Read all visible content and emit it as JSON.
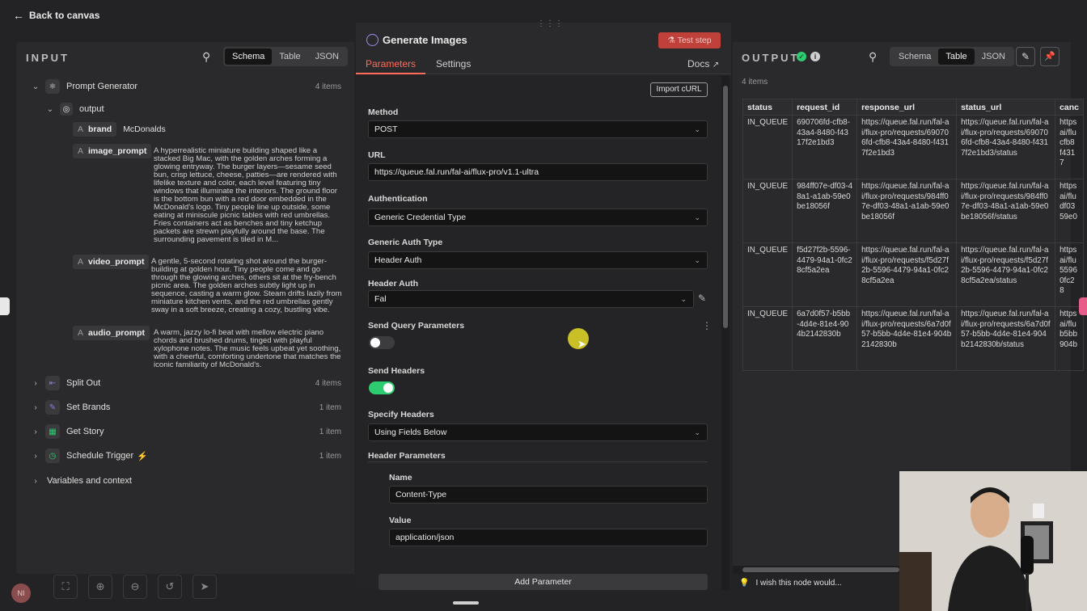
{
  "nav": {
    "back_label": "Back to canvas"
  },
  "input": {
    "title": "INPUT",
    "view_tabs": [
      "Schema",
      "Table",
      "JSON"
    ],
    "active_tab": "Schema",
    "root_node": {
      "name": "Prompt Generator",
      "count": "4 items"
    },
    "output_key": "output",
    "fields": [
      {
        "key": "brand",
        "value": "McDonalds"
      },
      {
        "key": "image_prompt",
        "value": "A hyperrealistic miniature building shaped like a stacked Big Mac, with the golden arches forming a glowing entryway. The burger layers—sesame seed bun, crisp lettuce, cheese, patties—are rendered with lifelike texture and color, each level featuring tiny windows that illuminate the interiors. The ground floor is the bottom bun with a red door embedded in the McDonald's logo. Tiny people line up outside, some eating at miniscule picnic tables with red umbrellas. Fries containers act as benches and tiny ketchup packets are strewn playfully around the base. The surrounding pavement is tiled in M..."
      },
      {
        "key": "video_prompt",
        "value": "A gentle, 5-second rotating shot around the burger-building at golden hour. Tiny people come and go through the glowing arches, others sit at the fry-bench picnic area. The golden arches subtly light up in sequence, casting a warm glow. Steam drifts lazily from miniature kitchen vents, and the red umbrellas gently sway in a soft breeze, creating a cozy, bustling vibe."
      },
      {
        "key": "audio_prompt",
        "value": "A warm, jazzy lo-fi beat with mellow electric piano chords and brushed drums, tinged with playful xylophone notes. The music feels upbeat yet soothing, with a cheerful, comforting undertone that matches the iconic familiarity of McDonald's."
      }
    ],
    "other_nodes": [
      {
        "name": "Split Out",
        "count": "4 items",
        "color": "#7b5cd6"
      },
      {
        "name": "Set Brands",
        "count": "1 item",
        "color": "#6a55c8"
      },
      {
        "name": "Get Story",
        "count": "1 item",
        "color": "#2e9d55"
      },
      {
        "name": "Schedule Trigger",
        "count": "1 item",
        "color": "#22a06b"
      }
    ],
    "variables_label": "Variables and context"
  },
  "params": {
    "node_title": "Generate Images",
    "test_step_label": "Test step",
    "tabs": [
      "Parameters",
      "Settings"
    ],
    "docs_label": "Docs",
    "import_curl_label": "Import cURL",
    "method_label": "Method",
    "method_value": "POST",
    "url_label": "URL",
    "url_value": "https://queue.fal.run/fal-ai/flux-pro/v1.1-ultra",
    "auth_label": "Authentication",
    "auth_value": "Generic Credential Type",
    "generic_auth_label": "Generic Auth Type",
    "generic_auth_value": "Header Auth",
    "header_auth_label": "Header Auth",
    "header_auth_value": "Fal",
    "send_query_label": "Send Query Parameters",
    "send_query_on": false,
    "send_headers_label": "Send Headers",
    "send_headers_on": true,
    "specify_headers_label": "Specify Headers",
    "specify_headers_value": "Using Fields Below",
    "header_params_label": "Header Parameters",
    "name_label": "Name",
    "name_value": "Content-Type",
    "value_label": "Value",
    "value_value": "application/json",
    "add_param_label": "Add Parameter"
  },
  "output": {
    "title": "OUTPUT",
    "view_tabs": [
      "Schema",
      "Table",
      "JSON"
    ],
    "active_tab": "Table",
    "count": "4 items",
    "columns": [
      "status",
      "request_id",
      "response_url",
      "status_url",
      "canc"
    ],
    "rows": [
      [
        "IN_QUEUE",
        "690706fd-cfb8-43a4-8480-f4317f2e1bd3",
        "https://queue.fal.run/fal-ai/flux-pro/requests/690706fd-cfb8-43a4-8480-f4317f2e1bd3",
        "https://queue.fal.run/fal-ai/flux-pro/requests/690706fd-cfb8-43a4-8480-f4317f2e1bd3/status",
        "https ai/flu cfb8 f4317"
      ],
      [
        "IN_QUEUE",
        "984ff07e-df03-48a1-a1ab-59e0be18056f",
        "https://queue.fal.run/fal-ai/flux-pro/requests/984ff07e-df03-48a1-a1ab-59e0be18056f",
        "https://queue.fal.run/fal-ai/flux-pro/requests/984ff07e-df03-48a1-a1ab-59e0be18056f/status",
        "https ai/flu df03 59e0"
      ],
      [
        "IN_QUEUE",
        "f5d27f2b-5596-4479-94a1-0fc28cf5a2ea",
        "https://queue.fal.run/fal-ai/flux-pro/requests/f5d27f2b-5596-4479-94a1-0fc28cf5a2ea",
        "https://queue.fal.run/fal-ai/flux-pro/requests/f5d27f2b-5596-4479-94a1-0fc28cf5a2ea/status",
        "https ai/flu 5596 0fc28"
      ],
      [
        "IN_QUEUE",
        "6a7d0f57-b5bb-4d4e-81e4-904b2142830b",
        "https://queue.fal.run/fal-ai/flux-pro/requests/6a7d0f57-b5bb-4d4e-81e4-904b2142830b",
        "https://queue.fal.run/fal-ai/flux-pro/requests/6a7d0f57-b5bb-4d4e-81e4-904b2142830b/status",
        "https ai/flu b5bb 904b"
      ]
    ]
  },
  "feedback": {
    "label": "I wish this node would..."
  },
  "avatar_initials": "NI",
  "colors": {
    "accent": "#ff6d5a",
    "toggle_on": "#2ecc71",
    "success": "#2ecc71"
  }
}
